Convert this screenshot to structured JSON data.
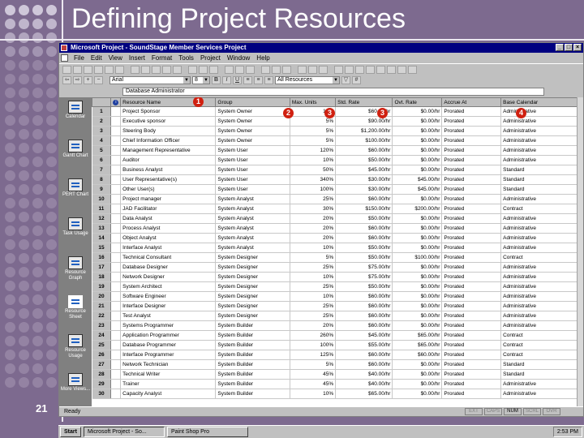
{
  "slide": {
    "title": "Defining Project Resources",
    "number": "21"
  },
  "window": {
    "title": "Microsoft Project - SoundStage Member Services Project"
  },
  "menu": [
    "File",
    "Edit",
    "View",
    "Insert",
    "Format",
    "Tools",
    "Project",
    "Window",
    "Help"
  ],
  "format_bar": {
    "font": "Arial",
    "size": "8",
    "filter": "All Resources"
  },
  "entry_bar": {
    "value": "Database Administrator"
  },
  "view_bar": [
    {
      "label": "Calendar",
      "icon": "calendar-icon"
    },
    {
      "label": "Gantt Chart",
      "icon": "gantt-chart-icon"
    },
    {
      "label": "PERT Chart",
      "icon": "pert-chart-icon"
    },
    {
      "label": "Task Usage",
      "icon": "task-usage-icon"
    },
    {
      "label": "Resource Graph",
      "icon": "resource-graph-icon"
    },
    {
      "label": "Resource Sheet",
      "icon": "resource-sheet-icon"
    },
    {
      "label": "Resource Usage",
      "icon": "resource-usage-icon"
    },
    {
      "label": "More Views...",
      "icon": "more-views-icon"
    }
  ],
  "table": {
    "columns": [
      "Resource Name",
      "Group",
      "Max. Units",
      "Std. Rate",
      "Ovt. Rate",
      "Accrue At",
      "Base Calendar"
    ],
    "rows": [
      {
        "n": "1",
        "name": "Project Sponsor",
        "group": "System Owner",
        "units": "10%",
        "std": "$60.00/hr",
        "ovt": "$0.00/hr",
        "accrue": "Prorated",
        "cal": "Administrative"
      },
      {
        "n": "2",
        "name": "Executive sponsor",
        "group": "System Owner",
        "units": "5%",
        "std": "$90.00/hr",
        "ovt": "$0.00/hr",
        "accrue": "Prorated",
        "cal": "Administrative"
      },
      {
        "n": "3",
        "name": "Steering Body",
        "group": "System Owner",
        "units": "5%",
        "std": "$1,200.00/hr",
        "ovt": "$0.00/hr",
        "accrue": "Prorated",
        "cal": "Administrative"
      },
      {
        "n": "4",
        "name": "Chief Information Officer",
        "group": "System Owner",
        "units": "5%",
        "std": "$100.00/hr",
        "ovt": "$0.00/hr",
        "accrue": "Prorated",
        "cal": "Administrative"
      },
      {
        "n": "5",
        "name": "Management Representative",
        "group": "System User",
        "units": "120%",
        "std": "$60.00/hr",
        "ovt": "$0.00/hr",
        "accrue": "Prorated",
        "cal": "Administrative"
      },
      {
        "n": "6",
        "name": "Auditor",
        "group": "System User",
        "units": "10%",
        "std": "$50.00/hr",
        "ovt": "$0.00/hr",
        "accrue": "Prorated",
        "cal": "Administrative"
      },
      {
        "n": "7",
        "name": "Business Analyst",
        "group": "System User",
        "units": "50%",
        "std": "$45.00/hr",
        "ovt": "$0.00/hr",
        "accrue": "Prorated",
        "cal": "Standard"
      },
      {
        "n": "8",
        "name": "User Representative(s)",
        "group": "System User",
        "units": "340%",
        "std": "$30.00/hr",
        "ovt": "$45.00/hr",
        "accrue": "Prorated",
        "cal": "Standard"
      },
      {
        "n": "9",
        "name": "Other User(s)",
        "group": "System User",
        "units": "100%",
        "std": "$30.00/hr",
        "ovt": "$45.00/hr",
        "accrue": "Prorated",
        "cal": "Standard"
      },
      {
        "n": "10",
        "name": "Project manager",
        "group": "System Analyst",
        "units": "25%",
        "std": "$60.00/hr",
        "ovt": "$0.00/hr",
        "accrue": "Prorated",
        "cal": "Administrative"
      },
      {
        "n": "11",
        "name": "JAD Facilitator",
        "group": "System Analyst",
        "units": "30%",
        "std": "$150.00/hr",
        "ovt": "$200.00/hr",
        "accrue": "Prorated",
        "cal": "Contract"
      },
      {
        "n": "12",
        "name": "Data Analyst",
        "group": "System Analyst",
        "units": "20%",
        "std": "$50.00/hr",
        "ovt": "$0.00/hr",
        "accrue": "Prorated",
        "cal": "Administrative"
      },
      {
        "n": "13",
        "name": "Process Analyst",
        "group": "System Analyst",
        "units": "20%",
        "std": "$60.00/hr",
        "ovt": "$0.00/hr",
        "accrue": "Prorated",
        "cal": "Administrative"
      },
      {
        "n": "14",
        "name": "Object Analyst",
        "group": "System Analyst",
        "units": "20%",
        "std": "$60.00/hr",
        "ovt": "$0.00/hr",
        "accrue": "Prorated",
        "cal": "Administrative"
      },
      {
        "n": "15",
        "name": "Interface Analyst",
        "group": "System Analyst",
        "units": "10%",
        "std": "$50.00/hr",
        "ovt": "$0.00/hr",
        "accrue": "Prorated",
        "cal": "Administrative"
      },
      {
        "n": "16",
        "name": "Technical Consultant",
        "group": "System Designer",
        "units": "5%",
        "std": "$50.00/hr",
        "ovt": "$100.00/hr",
        "accrue": "Prorated",
        "cal": "Contract"
      },
      {
        "n": "17",
        "name": "Database Designer",
        "group": "System Designer",
        "units": "25%",
        "std": "$75.00/hr",
        "ovt": "$0.00/hr",
        "accrue": "Prorated",
        "cal": "Administrative"
      },
      {
        "n": "18",
        "name": "Network Designer",
        "group": "System Designer",
        "units": "10%",
        "std": "$75.00/hr",
        "ovt": "$0.00/hr",
        "accrue": "Prorated",
        "cal": "Administrative"
      },
      {
        "n": "19",
        "name": "System Architect",
        "group": "System Designer",
        "units": "25%",
        "std": "$50.00/hr",
        "ovt": "$0.00/hr",
        "accrue": "Prorated",
        "cal": "Administrative"
      },
      {
        "n": "20",
        "name": "Software Engineer",
        "group": "System Designer",
        "units": "10%",
        "std": "$60.00/hr",
        "ovt": "$0.00/hr",
        "accrue": "Prorated",
        "cal": "Administrative"
      },
      {
        "n": "21",
        "name": "Interface Designer",
        "group": "System Designer",
        "units": "25%",
        "std": "$60.00/hr",
        "ovt": "$0.00/hr",
        "accrue": "Prorated",
        "cal": "Administrative"
      },
      {
        "n": "22",
        "name": "Test Analyst",
        "group": "System Designer",
        "units": "25%",
        "std": "$60.00/hr",
        "ovt": "$0.00/hr",
        "accrue": "Prorated",
        "cal": "Administrative"
      },
      {
        "n": "23",
        "name": "Systems Programmer",
        "group": "System Builder",
        "units": "20%",
        "std": "$60.00/hr",
        "ovt": "$0.00/hr",
        "accrue": "Prorated",
        "cal": "Administrative"
      },
      {
        "n": "24",
        "name": "Application Programmer",
        "group": "System Builder",
        "units": "260%",
        "std": "$45.00/hr",
        "ovt": "$65.00/hr",
        "accrue": "Prorated",
        "cal": "Contract"
      },
      {
        "n": "25",
        "name": "Database Programmer",
        "group": "System Builder",
        "units": "100%",
        "std": "$55.00/hr",
        "ovt": "$65.00/hr",
        "accrue": "Prorated",
        "cal": "Contract"
      },
      {
        "n": "26",
        "name": "Interface Programmer",
        "group": "System Builder",
        "units": "125%",
        "std": "$60.00/hr",
        "ovt": "$60.00/hr",
        "accrue": "Prorated",
        "cal": "Contract"
      },
      {
        "n": "27",
        "name": "Network Technician",
        "group": "System Builder",
        "units": "5%",
        "std": "$60.00/hr",
        "ovt": "$0.00/hr",
        "accrue": "Prorated",
        "cal": "Standard"
      },
      {
        "n": "28",
        "name": "Technical Writer",
        "group": "System Builder",
        "units": "45%",
        "std": "$40.00/hr",
        "ovt": "$0.00/hr",
        "accrue": "Prorated",
        "cal": "Standard"
      },
      {
        "n": "29",
        "name": "Trainer",
        "group": "System Builder",
        "units": "45%",
        "std": "$40.00/hr",
        "ovt": "$0.00/hr",
        "accrue": "Prorated",
        "cal": "Administrative"
      },
      {
        "n": "30",
        "name": "Capacity Analyst",
        "group": "System Builder",
        "units": "10%",
        "std": "$65.00/hr",
        "ovt": "$0.00/hr",
        "accrue": "Prorated",
        "cal": "Administrative"
      }
    ]
  },
  "markers": [
    "1",
    "2",
    "3",
    "3",
    "4"
  ],
  "status": {
    "text": "Ready",
    "indicators": [
      "EXT",
      "CAPS",
      "NUM",
      "SCRL",
      "OVR"
    ]
  },
  "taskbar": {
    "start": "Start",
    "tasks": [
      "Microsoft Project - So...",
      "Paint Shop Pro"
    ],
    "clock": "2:53 PM"
  },
  "colors": {
    "slide_bg": "#7d6a8f",
    "marker": "#d02010",
    "titlebar": "#000080"
  }
}
